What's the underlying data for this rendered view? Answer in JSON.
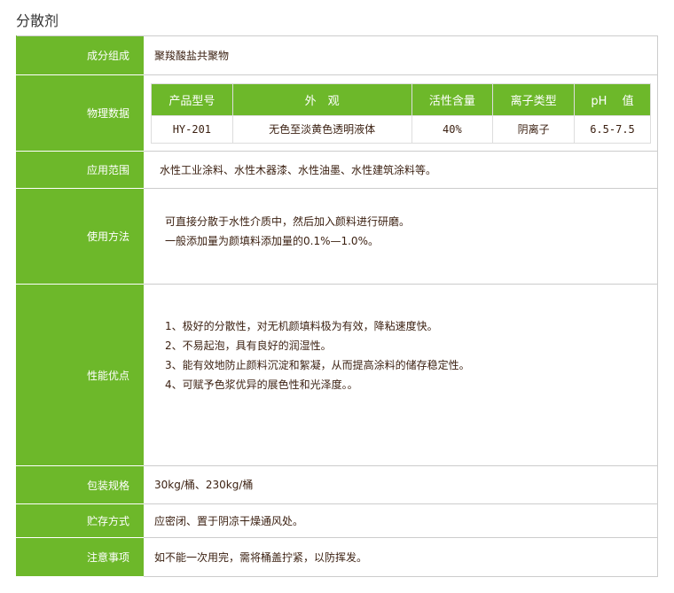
{
  "title": "分散剂",
  "rows": {
    "composition": {
      "label": "成分组成",
      "value": "聚羧酸盐共聚物"
    },
    "physical": {
      "label": "物理数据",
      "headers": [
        "产品型号",
        "外　观",
        "活性含量",
        "离子类型",
        "pH　 值"
      ],
      "cells": [
        "HY-201",
        "无色至淡黄色透明液体",
        "40%",
        "阴离子",
        "6.5-7.5"
      ]
    },
    "application": {
      "label": "应用范围",
      "value": "水性工业涂料、水性木器漆、水性油墨、水性建筑涂料等。"
    },
    "usage": {
      "label": "使用方法",
      "lines": [
        "可直接分散于水性介质中，然后加入颜料进行研磨。",
        "一般添加量为颜填料添加量的0.1%—1.0%。"
      ]
    },
    "advantages": {
      "label": "性能优点",
      "lines": [
        "1、极好的分散性，对无机颜填料极为有效，降粘速度快。",
        "2、不易起泡，具有良好的润湿性。",
        "3、能有效地防止颜料沉淀和絮凝，从而提高涂料的储存稳定性。",
        "4、可赋予色浆优异的展色性和光泽度。。"
      ]
    },
    "packaging": {
      "label": "包装规格",
      "value": "30kg/桶、230kg/桶"
    },
    "storage": {
      "label": "贮存方式",
      "value": "应密闭、置于阴凉干燥通风处。"
    },
    "notes": {
      "label": "注意事项",
      "value": "如不能一次用完，需将桶盖拧紧，以防挥发。"
    }
  }
}
